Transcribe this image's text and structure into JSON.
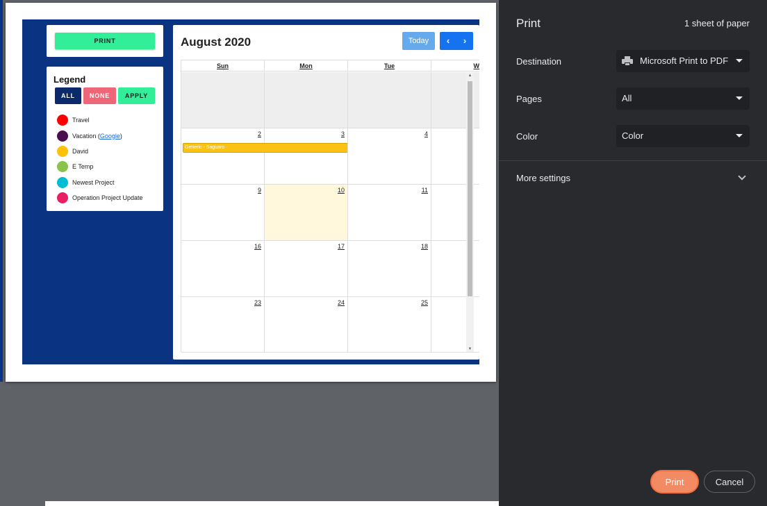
{
  "preview": {
    "print_button": "PRINT",
    "legend": {
      "title": "Legend",
      "buttons": {
        "all": "ALL",
        "none": "NONE",
        "apply": "APPLY"
      },
      "items": [
        {
          "label": "Travel",
          "color": "#ff0000"
        },
        {
          "label": "Vacation (",
          "link": "Google",
          "suffix": ")",
          "color": "#4a0f4f"
        },
        {
          "label": "David",
          "color": "#ffc107"
        },
        {
          "label": "E Temp",
          "color": "#8bc34a"
        },
        {
          "label": "Newest Project",
          "color": "#00bcd4"
        },
        {
          "label": "Operation Project Update",
          "color": "#e91e63"
        }
      ]
    },
    "calendar": {
      "title": "August 2020",
      "today_button": "Today",
      "prev_icon": "‹",
      "next_icon": "›",
      "weekdays": [
        "Sun",
        "Mon",
        "Tue",
        "W"
      ],
      "weeks": [
        [
          "",
          "",
          "",
          ""
        ],
        [
          "2",
          "3",
          "4",
          ""
        ],
        [
          "9",
          "10",
          "11",
          ""
        ],
        [
          "16",
          "17",
          "18",
          ""
        ],
        [
          "23",
          "24",
          "25",
          ""
        ]
      ],
      "event": {
        "title": "Generic - Saguaro",
        "color": "#fbc216"
      }
    }
  },
  "panel": {
    "title": "Print",
    "sheet_count": "1 sheet of paper",
    "destination": {
      "label": "Destination",
      "value": "Microsoft Print to PDF"
    },
    "pages": {
      "label": "Pages",
      "value": "All"
    },
    "color": {
      "label": "Color",
      "value": "Color"
    },
    "more_settings": "More settings",
    "print_button": "Print",
    "cancel_button": "Cancel"
  },
  "colors": {
    "accent": "#f28b64",
    "panel_bg": "#292a2d",
    "page_bg": "#0a3382"
  }
}
